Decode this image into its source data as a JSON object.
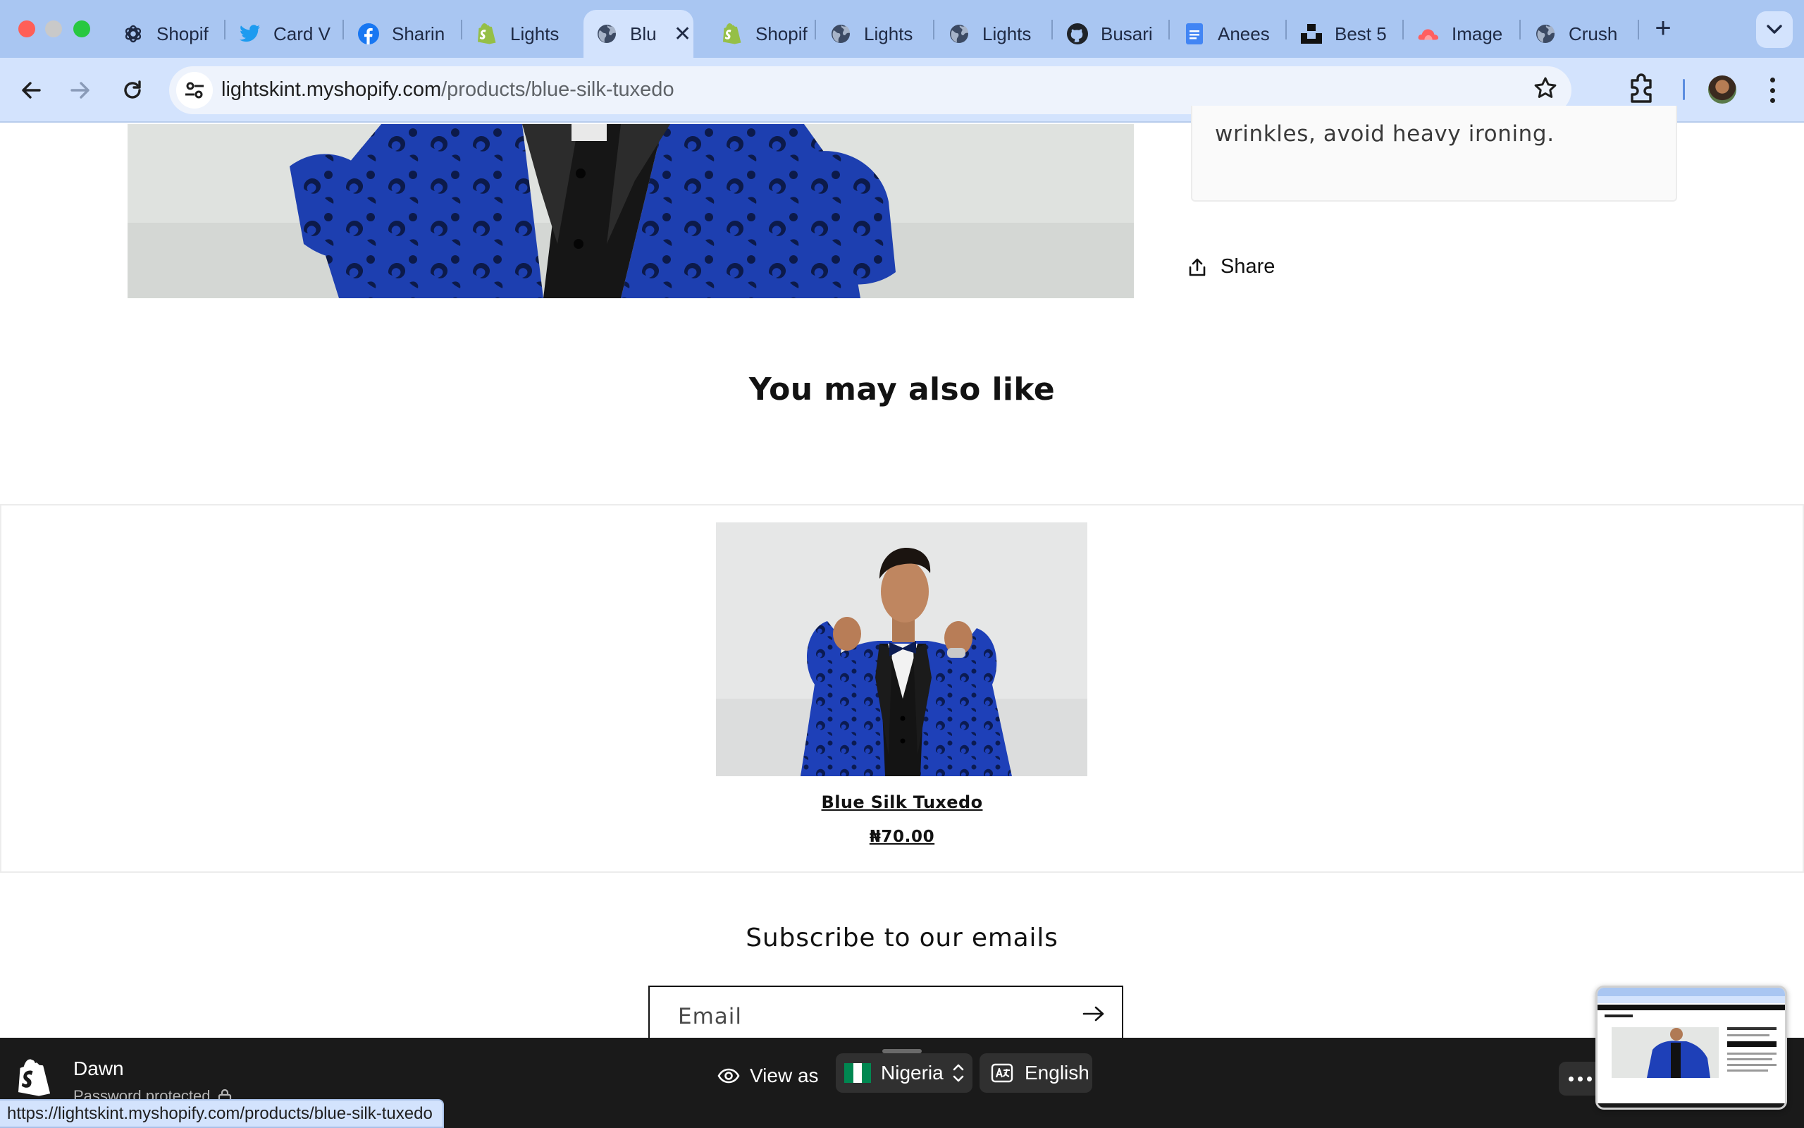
{
  "browser": {
    "tabs": [
      {
        "label": "Shopif",
        "icon": "openai-icon"
      },
      {
        "label": "Card V",
        "icon": "twitter-icon"
      },
      {
        "label": "Sharin",
        "icon": "facebook-icon"
      },
      {
        "label": "Lights",
        "icon": "shopify-icon"
      },
      {
        "label": "Blu",
        "icon": "globe-icon",
        "active": true
      },
      {
        "label": "Shopif",
        "icon": "shopify-icon"
      },
      {
        "label": "Lights",
        "icon": "globe-icon"
      },
      {
        "label": "Lights",
        "icon": "globe-icon"
      },
      {
        "label": "Busari",
        "icon": "github-icon"
      },
      {
        "label": "Anees",
        "icon": "docs-icon"
      },
      {
        "label": "Best 5",
        "icon": "unsplash-icon"
      },
      {
        "label": "Image",
        "icon": "cloud-icon"
      },
      {
        "label": "Crush",
        "icon": "globe-icon"
      }
    ],
    "close_glyph": "✕",
    "new_tab_glyph": "+",
    "url_domain": "lightskint.myshopify.com",
    "url_path": "/products/blue-silk-tuxedo",
    "status_url": "https://lightskint.myshopify.com/products/blue-silk-tuxedo"
  },
  "product": {
    "description_tail": "wrinkles, avoid heavy ironing.",
    "share_label": "Share"
  },
  "recommendations": {
    "heading": "You may also like",
    "items": [
      {
        "title": "Blue Silk Tuxedo",
        "price": "₦70.00"
      }
    ]
  },
  "newsletter": {
    "heading": "Subscribe to our emails",
    "email_label": "Email"
  },
  "preview_bar": {
    "theme_name": "Dawn",
    "theme_status": "Password protected",
    "view_as_label": "View as",
    "country": "Nigeria",
    "language": "English"
  },
  "colors": {
    "tab_strip": "#a9c6f2",
    "toolbar": "#d3e3fd",
    "tuxedo_blue": "#1e3a8a",
    "preview_bar": "#1a1a1a",
    "nigeria_green": "#008751"
  }
}
